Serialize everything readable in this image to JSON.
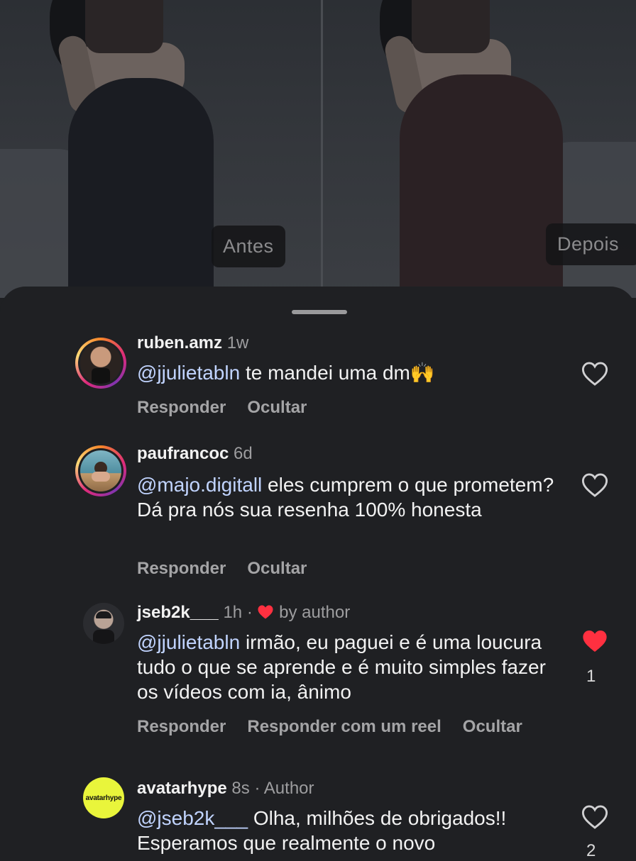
{
  "media": {
    "before_label": "Antes",
    "after_label": "Depois"
  },
  "comments": [
    {
      "username": "ruben.amz",
      "age": "1w",
      "mention": "@jjulietabln",
      "text": " te mandei uma dm🙌",
      "reply_label": "Responder",
      "hide_label": "Ocultar",
      "liked": false
    },
    {
      "username": "paufrancoc",
      "age": "6d",
      "mention": "@majo.digitall",
      "text": " eles cumprem o que prometem? Dá pra nós sua resenha 100% honesta",
      "reply_label": "Responder",
      "hide_label": "Ocultar",
      "liked": false
    },
    {
      "username": "jseb2k___",
      "age": "1h",
      "author_like": "by author",
      "mention": "@jjulietabln",
      "text": " irmão, eu paguei e é uma loucura tudo o que se aprende e é muito simples fazer os vídeos com ia, ânimo",
      "reply_label": "Responder",
      "reel_reply_label": "Responder com um reel",
      "hide_label": "Ocultar",
      "liked": true,
      "like_count": "1"
    },
    {
      "username": "avatarhype",
      "age": "8s",
      "badge": "Author",
      "avatar_text": "avatarhype",
      "mention": "@jseb2k___",
      "text": " Olha, milhões de obrigados!! Esperamos que realmente o novo",
      "liked": false,
      "like_count": "2"
    }
  ],
  "colors": {
    "background": "#1f2023",
    "mention": "#c1d4ff",
    "liked_heart": "#ff3040",
    "brand_avatar": "#e9f53b"
  },
  "icons": {
    "like": "heart-outline-icon",
    "liked": "heart-filled-icon"
  }
}
